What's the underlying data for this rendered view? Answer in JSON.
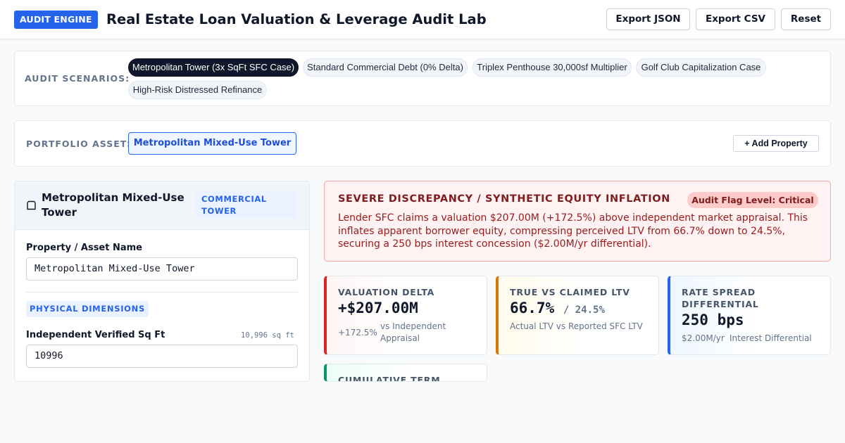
{
  "header": {
    "badge": "AUDIT ENGINE",
    "title": "Real Estate Loan Valuation & Leverage Audit Lab",
    "buttons": {
      "export_json": "Export JSON",
      "export_csv": "Export CSV",
      "reset": "Reset"
    }
  },
  "scenarios": {
    "label": "AUDIT SCENARIOS:",
    "chips": [
      "Metropolitan Tower (3x SqFt SFC Case)",
      "Standard Commercial Debt (0% Delta)",
      "Triplex Penthouse 30,000sf Multiplier",
      "Golf Club Capitalization Case",
      "High-Risk Distressed Refinance"
    ],
    "active_index": 0
  },
  "portfolio": {
    "label": "PORTFOLIO ASSETS:",
    "assets": [
      "Metropolitan Mixed-Use Tower"
    ],
    "add_button": "+ Add Property"
  },
  "property_panel": {
    "title": "Metropolitan Mixed-Use Tower",
    "type_tag": "COMMERCIAL TOWER",
    "name_label": "Property / Asset Name",
    "name_value": "Metropolitan Mixed-Use Tower",
    "section_tag": "PHYSICAL DIMENSIONS",
    "sqft_label": "Independent Verified Sq Ft",
    "sqft_hint": "10,996 sq ft",
    "sqft_value": "10996",
    "icon": "building-icon"
  },
  "alert": {
    "title": "SEVERE DISCREPANCY / SYNTHETIC EQUITY INFLATION",
    "badge": "Audit Flag Level: Critical",
    "body": "Lender SFC claims a valuation $207.00M (+172.5%) above independent market appraisal. This inflates apparent borrower equity, compressing perceived LTV from 66.7% down to 24.5%, securing a 250 bps interest concession ($2.00M/yr differential)."
  },
  "metrics": {
    "valuation_delta": {
      "label": "VALUATION DELTA",
      "value": "+$207.00M",
      "sub_a": "+172.5%",
      "sub_b": "vs Independent Appraisal"
    },
    "ltv": {
      "label": "TRUE VS CLAIMED LTV",
      "value": "66.7%",
      "value_sub": "/ 24.5%",
      "sub": "Actual LTV vs Reported SFC LTV"
    },
    "rate_spread": {
      "label": "RATE SPREAD DIFFERENTIAL",
      "value": "250 bps",
      "sub_a": "$2.00M/yr",
      "sub_b": "Interest Differential"
    },
    "cumulative": {
      "label": "CUMULATIVE TERM"
    }
  },
  "colors": {
    "accent": "#2563eb",
    "critical": "#dc2626",
    "warning": "#d97706",
    "positive": "#059669",
    "dark": "#0f172a"
  }
}
